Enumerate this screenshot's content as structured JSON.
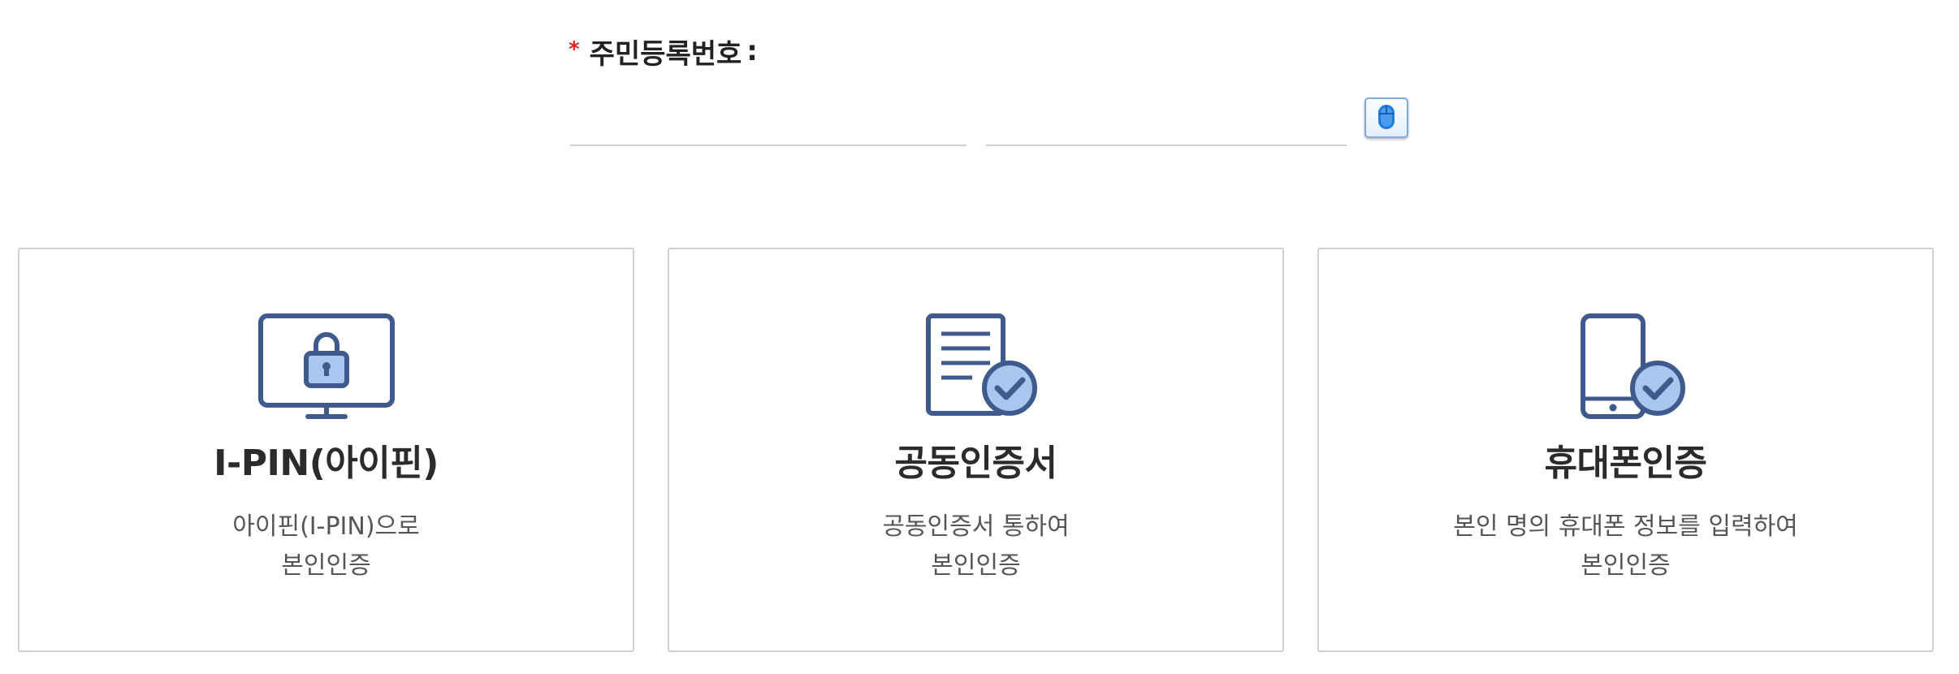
{
  "ssn_field": {
    "required_mark": "*",
    "label": "주민등록번호",
    "colon": ":",
    "front_value": "",
    "back_value": ""
  },
  "keypad": {
    "icon": "mouse-icon",
    "accent_color": "#1e7be0"
  },
  "auth_methods": [
    {
      "icon": "monitor-lock-icon",
      "title": "I-PIN(아이핀)",
      "desc_line1": "아이핀(I-PIN)으로",
      "desc_line2": "본인인증"
    },
    {
      "icon": "document-check-icon",
      "title": "공동인증서",
      "desc_line1": "공동인증서 통하여",
      "desc_line2": "본인인증"
    },
    {
      "icon": "phone-check-icon",
      "title": "휴대폰인증",
      "desc_line1": "본인 명의 휴대폰 정보를 입력하여",
      "desc_line2": "본인인증"
    }
  ],
  "colors": {
    "icon_stroke": "#3f5a8c",
    "icon_fill": "#a9c7ee",
    "required": "#e0201b"
  }
}
